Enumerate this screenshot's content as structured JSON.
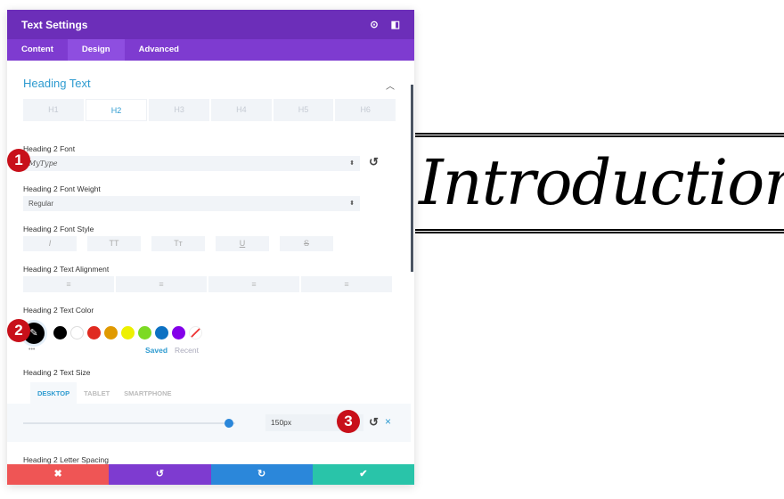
{
  "header": {
    "title": "Text Settings",
    "icons": [
      "focus-icon",
      "sidebar-toggle-icon"
    ]
  },
  "tabs": [
    "Content",
    "Design",
    "Advanced"
  ],
  "active_tab": "Design",
  "section": {
    "title": "Heading Text"
  },
  "heading_tabs": [
    "H1",
    "H2",
    "H3",
    "H4",
    "H5",
    "H6"
  ],
  "active_heading": "H2",
  "font": {
    "label": "Heading 2 Font",
    "value": "MyType"
  },
  "weight": {
    "label": "Heading 2 Font Weight",
    "value": "Regular"
  },
  "style": {
    "label": "Heading 2 Font Style",
    "buttons": [
      "I",
      "TT",
      "Tт",
      "U",
      "S"
    ]
  },
  "alignment": {
    "label": "Heading 2 Text Alignment",
    "buttons": [
      "≡",
      "≡",
      "≡",
      "≡"
    ]
  },
  "color": {
    "label": "Heading 2 Text Color",
    "current": "#000000",
    "swatches": [
      "#000000",
      "#ffffff",
      "#e02b20",
      "#e09900",
      "#edf000",
      "#7cda24",
      "#0c71c3",
      "#8300e9"
    ],
    "saved": "Saved",
    "recent": "Recent",
    "more": "•••"
  },
  "size": {
    "label": "Heading 2 Text Size",
    "devices": [
      "DESKTOP",
      "TABLET",
      "SMARTPHONE"
    ],
    "value": "150px",
    "slider_fraction": 0.97
  },
  "letter_spacing": {
    "label": "Heading 2 Letter Spacing"
  },
  "badges": [
    "1",
    "2",
    "3"
  ],
  "footer": {
    "cancel": "✖",
    "undo": "↺",
    "redo": "↻",
    "save": "✔"
  },
  "preview": {
    "text": "Introduction"
  }
}
